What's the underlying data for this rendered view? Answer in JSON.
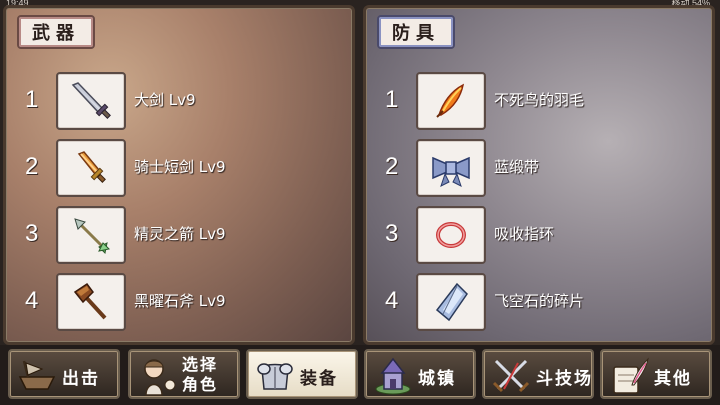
{
  "statusbar": {
    "time": "19:49",
    "carrier": "移动",
    "battery": "54%"
  },
  "weapons": {
    "title": "武器",
    "items": [
      {
        "num": "1",
        "name": "大剑 Lv9",
        "icon": "greatsword-icon"
      },
      {
        "num": "2",
        "name": "骑士短剑 Lv9",
        "icon": "short-sword-icon"
      },
      {
        "num": "3",
        "name": "精灵之箭 Lv9",
        "icon": "arrow-icon"
      },
      {
        "num": "4",
        "name": "黑曜石斧 Lv9",
        "icon": "axe-icon"
      }
    ]
  },
  "armor": {
    "title": "防具",
    "items": [
      {
        "num": "1",
        "name": "不死鸟的羽毛",
        "icon": "phoenix-feather-icon"
      },
      {
        "num": "2",
        "name": "蓝缎带",
        "icon": "blue-ribbon-icon"
      },
      {
        "num": "3",
        "name": "吸收指环",
        "icon": "ring-icon"
      },
      {
        "num": "4",
        "name": "飞空石的碎片",
        "icon": "crystal-shard-icon"
      }
    ]
  },
  "nav": {
    "attack": "出击",
    "select_line1": "选择",
    "select_line2": "角色",
    "equip": "装备",
    "town": "城镇",
    "arena": "斗技场",
    "other": "其他"
  }
}
